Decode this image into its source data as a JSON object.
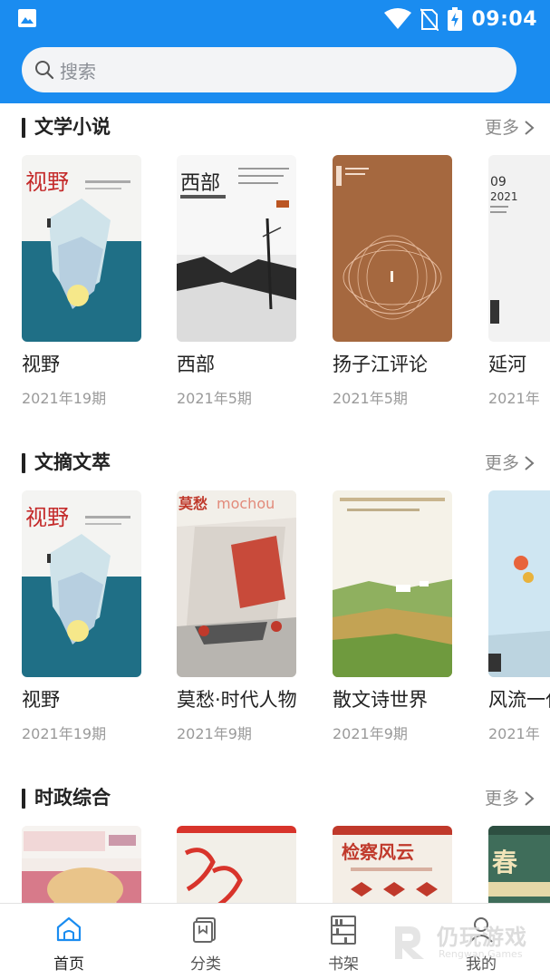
{
  "status": {
    "time": "09:04"
  },
  "search": {
    "placeholder": "搜索"
  },
  "sections": [
    {
      "title": "文学小说",
      "more": "更多",
      "books": [
        {
          "title": "视野",
          "issue": "2021年19期"
        },
        {
          "title": "西部",
          "issue": "2021年5期"
        },
        {
          "title": "扬子江评论",
          "issue": "2021年5期"
        },
        {
          "title": "延河",
          "issue": "2021年"
        }
      ]
    },
    {
      "title": "文摘文萃",
      "more": "更多",
      "books": [
        {
          "title": "视野",
          "issue": "2021年19期"
        },
        {
          "title": "莫愁·时代人物",
          "issue": "2021年9期"
        },
        {
          "title": "散文诗世界",
          "issue": "2021年9期"
        },
        {
          "title": "风流一代",
          "issue": "2021年"
        }
      ]
    },
    {
      "title": "时政综合",
      "more": "更多",
      "books": [
        {
          "title": "",
          "issue": ""
        },
        {
          "title": "",
          "issue": ""
        },
        {
          "title": "",
          "issue": ""
        },
        {
          "title": "",
          "issue": ""
        }
      ]
    }
  ],
  "covers": {
    "shiye_text": "视野",
    "xibu_text": "西部",
    "mochou_text": "莫愁",
    "jiancha_text": "检察风云"
  },
  "tabs": [
    {
      "label": "首页",
      "icon": "home-icon",
      "active": true
    },
    {
      "label": "分类",
      "icon": "category-icon",
      "active": false
    },
    {
      "label": "书架",
      "icon": "bookshelf-icon",
      "active": false
    },
    {
      "label": "我的",
      "icon": "profile-icon",
      "active": false
    }
  ],
  "watermark": {
    "text": "仍玩游戏",
    "sub": "Rengwan Games"
  },
  "colors": {
    "primary": "#1a8cf0",
    "active_tab": "#1a8cf0"
  }
}
